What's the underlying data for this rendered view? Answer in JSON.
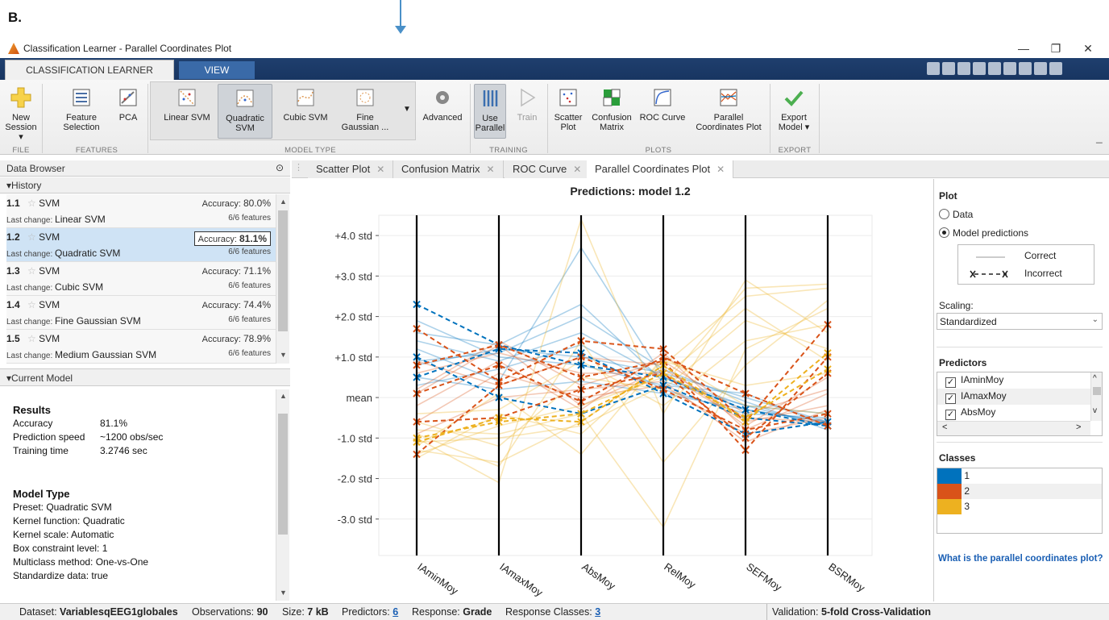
{
  "figure_label": "B.",
  "window": {
    "title": "Classification Learner - Parallel Coordinates Plot",
    "controls": [
      "—",
      "❐",
      "✕"
    ]
  },
  "toolstrip_tabs": [
    "CLASSIFICATION LEARNER",
    "VIEW"
  ],
  "ribbon": {
    "file": {
      "new_session": "New",
      "new_session_2": "Session ▾",
      "section": "FILE"
    },
    "features": {
      "feature_selection": "Feature",
      "feature_selection_2": "Selection",
      "pca": "PCA",
      "section": "FEATURES"
    },
    "model_type": {
      "items": [
        {
          "l1": "Linear SVM",
          "l2": ""
        },
        {
          "l1": "Quadratic",
          "l2": "SVM"
        },
        {
          "l1": "Cubic SVM",
          "l2": ""
        },
        {
          "l1": "Fine",
          "l2": "Gaussian ..."
        }
      ],
      "advanced": "Advanced",
      "section": "MODEL TYPE"
    },
    "training": {
      "use_parallel": "Use",
      "use_parallel_2": "Parallel",
      "train": "Train",
      "section": "TRAINING"
    },
    "plots": {
      "items": [
        {
          "l1": "Scatter",
          "l2": "Plot"
        },
        {
          "l1": "Confusion",
          "l2": "Matrix"
        },
        {
          "l1": "ROC Curve",
          "l2": ""
        },
        {
          "l1": "Parallel",
          "l2": "Coordinates Plot"
        }
      ],
      "section": "PLOTS"
    },
    "export": {
      "l1": "Export",
      "l2": "Model ▾",
      "section": "EXPORT"
    }
  },
  "data_browser": {
    "title": "Data Browser",
    "history_label": "▾History",
    "history": [
      {
        "num": "1.1",
        "name": "SVM",
        "acc_label": "Accuracy:",
        "acc": "80.0%",
        "change_label": "Last change:",
        "change": "Linear SVM",
        "features": "6/6 features"
      },
      {
        "num": "1.2",
        "name": "SVM",
        "acc_label": "Accuracy:",
        "acc": "81.1%",
        "change_label": "Last change:",
        "change": "Quadratic SVM",
        "features": "6/6 features"
      },
      {
        "num": "1.3",
        "name": "SVM",
        "acc_label": "Accuracy:",
        "acc": "71.1%",
        "change_label": "Last change:",
        "change": "Cubic SVM",
        "features": "6/6 features"
      },
      {
        "num": "1.4",
        "name": "SVM",
        "acc_label": "Accuracy:",
        "acc": "74.4%",
        "change_label": "Last change:",
        "change": "Fine Gaussian SVM",
        "features": "6/6 features"
      },
      {
        "num": "1.5",
        "name": "SVM",
        "acc_label": "Accuracy:",
        "acc": "78.9%",
        "change_label": "Last change:",
        "change": "Medium Gaussian SVM",
        "features": "6/6 features"
      }
    ],
    "selected_index": 1,
    "current_model_label": "▾Current Model",
    "results": {
      "heading": "Results",
      "rows": [
        {
          "k": "Accuracy",
          "v": "81.1%"
        },
        {
          "k": "Prediction speed",
          "v": "~1200 obs/sec"
        },
        {
          "k": "Training time",
          "v": "3.2746 sec"
        }
      ]
    },
    "model_type": {
      "heading": "Model Type",
      "lines": [
        "Preset: Quadratic SVM",
        "Kernel function: Quadratic",
        "Kernel scale: Automatic",
        "Box constraint level: 1",
        "Multiclass method: One-vs-One",
        "Standardize data: true"
      ]
    }
  },
  "doc_tabs": [
    "Scatter Plot",
    "Confusion Matrix",
    "ROC Curve",
    "Parallel Coordinates Plot"
  ],
  "active_doc_tab": 3,
  "chart_data": {
    "type": "parallel-coordinates",
    "title": "Predictions: model 1.2",
    "axes": [
      "IAminMoy",
      "IAmaxMoy",
      "AbsMoy",
      "RelMoy",
      "SEFMoy",
      "BSRMoy"
    ],
    "y_ticks": [
      "+4.0 std",
      "+3.0 std",
      "+2.0 std",
      "+1.0 std",
      "mean",
      "-1.0 std",
      "-2.0 std",
      "-3.0 std"
    ],
    "y_tick_values": [
      4,
      3,
      2,
      1,
      0,
      -1,
      -2,
      -3
    ],
    "ylim": [
      -3.9,
      4.5
    ],
    "class_colors": {
      "1": "#0072bd",
      "2": "#d95319",
      "3": "#edb120"
    },
    "correct_series": [
      {
        "cls": "1",
        "values": [
          0.8,
          1.2,
          1.0,
          0.6,
          0.0,
          -0.6
        ]
      },
      {
        "cls": "1",
        "values": [
          1.6,
          1.3,
          2.3,
          0.4,
          -0.2,
          -0.7
        ]
      },
      {
        "cls": "1",
        "values": [
          1.2,
          0.4,
          3.7,
          0.5,
          -0.3,
          -0.6
        ]
      },
      {
        "cls": "1",
        "values": [
          0.9,
          1.1,
          2.0,
          0.7,
          -0.1,
          -0.8
        ]
      },
      {
        "cls": "1",
        "values": [
          0.3,
          0.7,
          1.3,
          0.2,
          -0.4,
          -0.5
        ]
      },
      {
        "cls": "1",
        "values": [
          1.9,
          1.0,
          0.8,
          0.3,
          0.1,
          -0.7
        ]
      },
      {
        "cls": "1",
        "values": [
          0.5,
          0.2,
          0.4,
          0.1,
          -0.3,
          -0.6
        ]
      },
      {
        "cls": "1",
        "values": [
          1.4,
          0.9,
          1.6,
          0.5,
          -0.2,
          -0.4
        ]
      },
      {
        "cls": "2",
        "values": [
          0.2,
          1.4,
          0.3,
          0.9,
          -0.4,
          0.2
        ]
      },
      {
        "cls": "2",
        "values": [
          -0.2,
          0.9,
          -0.3,
          1.1,
          -0.8,
          0.1
        ]
      },
      {
        "cls": "2",
        "values": [
          0.6,
          1.1,
          0.6,
          0.6,
          -0.6,
          -0.2
        ]
      },
      {
        "cls": "2",
        "values": [
          -0.6,
          0.6,
          0.0,
          0.3,
          -0.9,
          -0.5
        ]
      },
      {
        "cls": "2",
        "values": [
          0.9,
          0.3,
          1.0,
          0.8,
          -0.7,
          0.5
        ]
      },
      {
        "cls": "2",
        "values": [
          -0.9,
          0.0,
          0.2,
          0.4,
          -1.1,
          -0.3
        ]
      },
      {
        "cls": "2",
        "values": [
          0.1,
          1.3,
          -0.2,
          0.7,
          -0.5,
          -0.6
        ]
      },
      {
        "cls": "3",
        "values": [
          -1.3,
          -1.6,
          -0.6,
          0.8,
          2.5,
          2.7
        ]
      },
      {
        "cls": "3",
        "values": [
          -1.0,
          -2.1,
          4.4,
          -0.4,
          2.9,
          1.6
        ]
      },
      {
        "cls": "3",
        "values": [
          -0.8,
          -0.9,
          -0.4,
          -3.2,
          1.2,
          2.2
        ]
      },
      {
        "cls": "3",
        "values": [
          -1.5,
          -0.4,
          -0.9,
          0.9,
          0.3,
          0.6
        ]
      },
      {
        "cls": "3",
        "values": [
          -0.6,
          -1.2,
          0.5,
          0.2,
          1.9,
          1.2
        ]
      },
      {
        "cls": "3",
        "values": [
          -1.2,
          0.1,
          -1.4,
          1.0,
          -0.2,
          -0.4
        ]
      },
      {
        "cls": "3",
        "values": [
          -0.9,
          -1.7,
          1.4,
          -1.6,
          0.8,
          2.4
        ]
      },
      {
        "cls": "3",
        "values": [
          -1.4,
          -0.7,
          -0.2,
          0.5,
          2.2,
          0.9
        ]
      },
      {
        "cls": "3",
        "values": [
          -0.4,
          -0.3,
          0.9,
          -0.2,
          1.4,
          1.8
        ]
      },
      {
        "cls": "3",
        "values": [
          -1.1,
          -1.0,
          -0.7,
          0.3,
          2.7,
          2.8
        ]
      }
    ],
    "incorrect_series": [
      {
        "cls": "1",
        "values": [
          2.3,
          1.3,
          0.8,
          0.5,
          -0.3,
          -0.7
        ]
      },
      {
        "cls": "1",
        "values": [
          1.0,
          0.0,
          -0.4,
          0.3,
          -0.5,
          -0.7
        ]
      },
      {
        "cls": "1",
        "values": [
          0.5,
          1.2,
          1.1,
          0.1,
          -0.9,
          -0.6
        ]
      },
      {
        "cls": "2",
        "values": [
          1.7,
          0.4,
          1.4,
          1.2,
          -0.6,
          1.8
        ]
      },
      {
        "cls": "2",
        "values": [
          0.8,
          1.3,
          0.5,
          0.9,
          -1.3,
          1.0
        ]
      },
      {
        "cls": "2",
        "values": [
          -0.6,
          -0.5,
          0.2,
          0.6,
          -1.0,
          0.6
        ]
      },
      {
        "cls": "2",
        "values": [
          -1.4,
          0.3,
          1.0,
          0.2,
          -0.8,
          -0.4
        ]
      },
      {
        "cls": "2",
        "values": [
          0.1,
          0.8,
          -0.1,
          1.0,
          0.1,
          -0.7
        ]
      },
      {
        "cls": "3",
        "values": [
          -1.1,
          -0.5,
          -0.6,
          0.8,
          -0.6,
          1.1
        ]
      },
      {
        "cls": "3",
        "values": [
          -1.0,
          -0.6,
          -0.4,
          0.6,
          -0.5,
          0.7
        ]
      }
    ]
  },
  "right_panel": {
    "plot_label": "Plot",
    "radio_data": "Data",
    "radio_preds": "Model predictions",
    "legend_correct": "Correct",
    "legend_incorrect": "Incorrect",
    "scaling_label": "Scaling:",
    "scaling_value": "Standardized",
    "predictors_label": "Predictors",
    "predictors": [
      "IAminMoy",
      "IAmaxMoy",
      "AbsMoy"
    ],
    "classes_label": "Classes",
    "classes": [
      {
        "name": "1",
        "color": "#0072bd"
      },
      {
        "name": "2",
        "color": "#d95319"
      },
      {
        "name": "3",
        "color": "#edb120"
      }
    ],
    "help_link": "What is the parallel coordinates plot?"
  },
  "status": {
    "dataset_label": "Dataset:",
    "dataset": "VariablesqEEG1globales",
    "obs_label": "Observations:",
    "obs": "90",
    "size_label": "Size:",
    "size": "7 kB",
    "pred_label": "Predictors:",
    "pred": "6",
    "resp_label": "Response:",
    "resp": "Grade",
    "rc_label": "Response Classes:",
    "rc": "3",
    "val_label": "Validation:",
    "val": "5-fold Cross-Validation"
  }
}
